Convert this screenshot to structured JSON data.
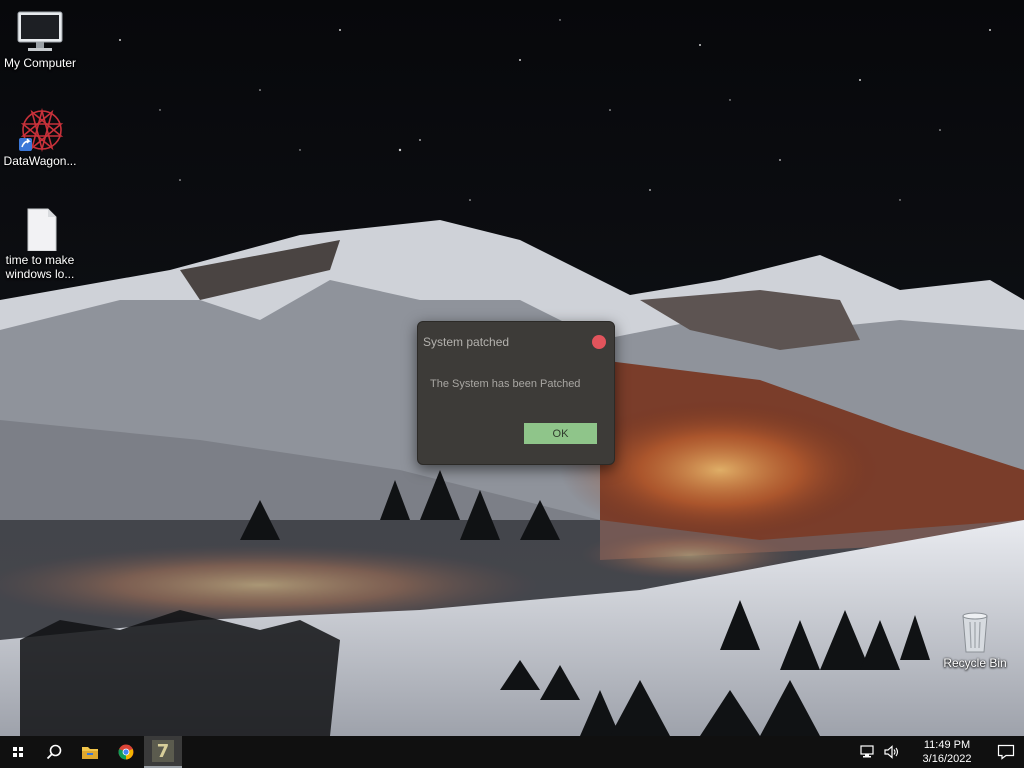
{
  "desktop": {
    "icons": [
      {
        "label": "My Computer",
        "icon": "computer-icon"
      },
      {
        "label": "DataWagon...",
        "icon": "datawagon-icon"
      },
      {
        "label": "time to make windows lo...",
        "icon": "document-icon"
      },
      {
        "label": "Recycle Bin",
        "icon": "recycle-bin-icon"
      }
    ]
  },
  "dialog": {
    "title": "System patched",
    "message": "The System has been Patched",
    "ok_label": "OK",
    "close_color": "#e2545c",
    "ok_color": "#8fc58a"
  },
  "taskbar": {
    "items": [
      "start-icon",
      "search-icon",
      "file-explorer-icon",
      "chrome-icon",
      "app-7-icon"
    ],
    "active_app_glyph": "7",
    "tray": [
      "network-icon",
      "volume-icon"
    ],
    "time": "11:49 PM",
    "date": "3/16/2022",
    "notification_icon": "notification-icon"
  }
}
